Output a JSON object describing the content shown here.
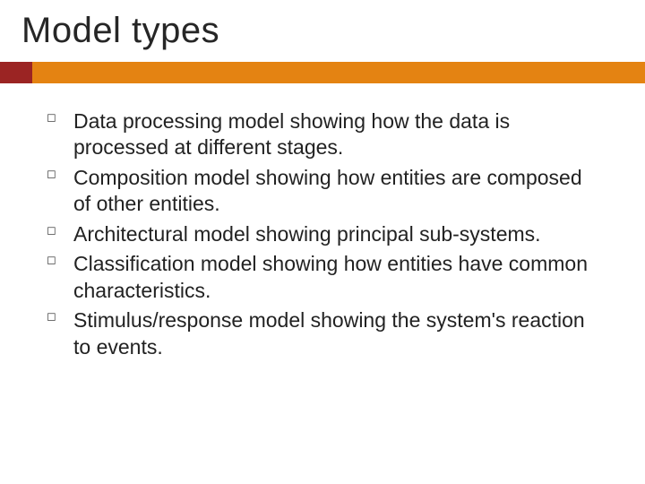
{
  "title": "Model types",
  "bullets": [
    {
      "text": "Data processing model showing how the data is processed at different stages."
    },
    {
      "text": "Composition model showing how entities are composed of other entities."
    },
    {
      "text": "Architectural model showing principal sub-systems."
    },
    {
      "text": "Classification model showing how entities have common characteristics."
    },
    {
      "text": "Stimulus/response model showing the system's reaction to events."
    }
  ],
  "colors": {
    "accent_bar_left": "#9b2423",
    "accent_bar_right": "#e48312"
  }
}
